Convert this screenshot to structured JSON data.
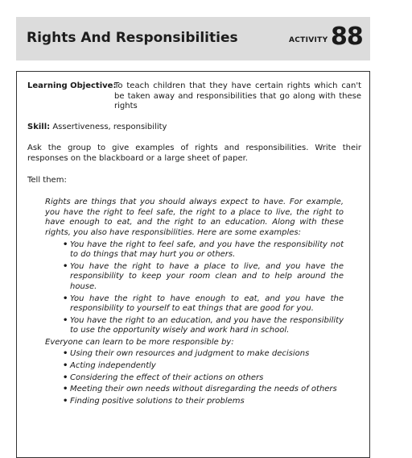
{
  "header": {
    "title": "Rights And Responsibilities",
    "activity_label": "ACTIVITY",
    "activity_number": "88"
  },
  "content": {
    "objective_label": "Learning Objective:",
    "objective_text": "To teach children that they have certain rights which can't be taken away and responsibilities that go along with these rights",
    "skill_label": "Skill:",
    "skill_text": " Assertiveness, responsibility",
    "instructions": "Ask the group to give examples of rights and responsibilities. Write their responses on the blackboard or a large sheet of paper.",
    "tell_them": "Tell them:",
    "italic_intro": "Rights are things that you should always expect to have. For example, you have the right to feel safe, the right to a place to live, the right to have enough to eat, and the right to an education. Along with these rights, you also have responsibilities. Here are some examples:",
    "rights_bullets": [
      "You have the right to feel safe, and you have the responsibility not to do things that may hurt you or others.",
      "You have the right to have a place to live, and you have the responsibility to keep your room clean and to help around the house.",
      "You have the right to have enough to eat, and you have the responsibility to yourself to eat things that are good for you.",
      "You have the right to an education, and you have the responsibility to use the opportunity wisely and work hard in school."
    ],
    "everyone_line": "Everyone can learn to be more responsible by:",
    "responsible_bullets": [
      "Using their own resources and judgment to make decisions",
      "Acting independently",
      "Considering the effect of their actions on others",
      "Meeting their own needs without disregarding the needs of others",
      "Finding positive solutions to their problems"
    ],
    "bullet_char": "•"
  }
}
